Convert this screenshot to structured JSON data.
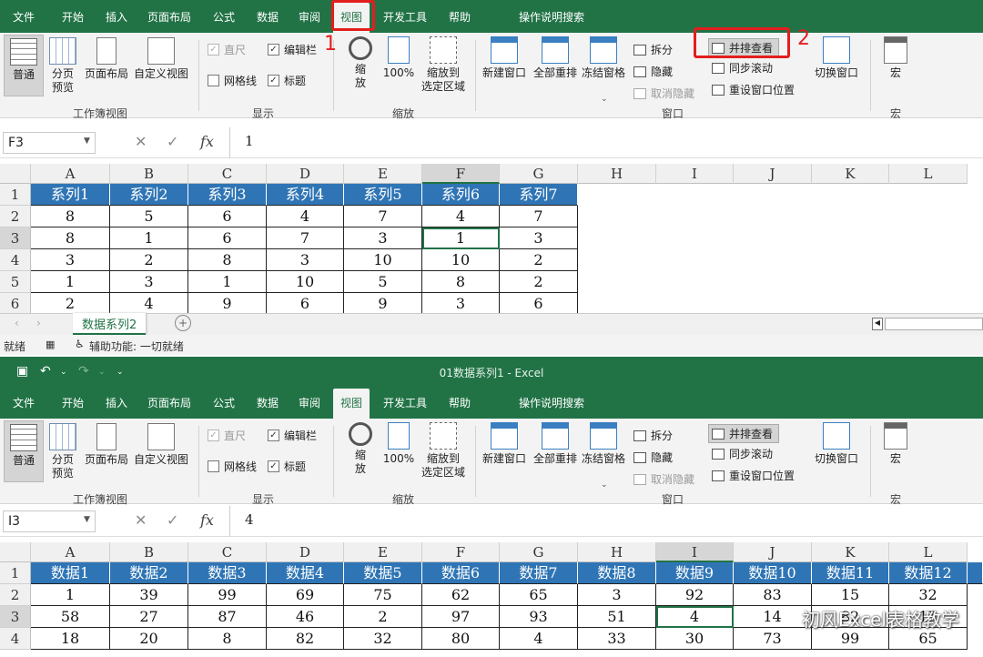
{
  "tabs": [
    "文件",
    "开始",
    "插入",
    "页面布局",
    "公式",
    "数据",
    "审阅",
    "视图",
    "开发工具",
    "帮助",
    "操作说明搜索"
  ],
  "ribbon": {
    "views": {
      "normal": "普通",
      "pagebreak": "分页\n预览",
      "pagelayout": "页面布局",
      "custom": "自定义视图",
      "group": "工作簿视图"
    },
    "show": {
      "ruler": "直尺",
      "formulabar": "编辑栏",
      "gridlines": "网格线",
      "headings": "标题",
      "group": "显示"
    },
    "zoom": {
      "zoom": "缩\n放",
      "z100": "100%",
      "zoomsel": "缩放到\n选定区域",
      "group": "缩放"
    },
    "window": {
      "newwin": "新建窗口",
      "arrange": "全部重排",
      "freeze": "冻结窗格",
      "split": "拆分",
      "hide": "隐藏",
      "unhide": "取消隐藏",
      "sbs": "并排查看",
      "sync": "同步滚动",
      "reset": "重设窗口位置",
      "switch": "切换窗口",
      "group": "窗口"
    },
    "macro": {
      "macro": "宏",
      "group": "宏"
    }
  },
  "annotations": {
    "a1": "1",
    "a2": "2"
  },
  "w1": {
    "namebox": "F3",
    "formula": "1",
    "cols": [
      "A",
      "B",
      "C",
      "D",
      "E",
      "F",
      "G",
      "H",
      "I",
      "J",
      "K",
      "L"
    ],
    "rows": [
      "1",
      "2",
      "3",
      "4",
      "5",
      "6"
    ],
    "header": [
      "系列1",
      "系列2",
      "系列3",
      "系列4",
      "系列5",
      "系列6",
      "系列7"
    ],
    "data": [
      [
        "8",
        "5",
        "6",
        "4",
        "7",
        "4",
        "7"
      ],
      [
        "8",
        "1",
        "6",
        "7",
        "3",
        "1",
        "3"
      ],
      [
        "3",
        "2",
        "8",
        "3",
        "10",
        "10",
        "2"
      ],
      [
        "1",
        "3",
        "1",
        "10",
        "5",
        "8",
        "2"
      ],
      [
        "2",
        "4",
        "9",
        "6",
        "9",
        "3",
        "6"
      ]
    ],
    "sheet": "数据系列2",
    "status": "就绪",
    "access": "辅助功能: 一切就绪"
  },
  "w2": {
    "title": "01数据系列1  -  Excel",
    "namebox": "I3",
    "formula": "4",
    "cols": [
      "A",
      "B",
      "C",
      "D",
      "E",
      "F",
      "G",
      "H",
      "I",
      "J",
      "K",
      "L"
    ],
    "rows": [
      "1",
      "2",
      "3",
      "4"
    ],
    "header": [
      "数据1",
      "数据2",
      "数据3",
      "数据4",
      "数据5",
      "数据6",
      "数据7",
      "数据8",
      "数据9",
      "数据10",
      "数据11",
      "数据12"
    ],
    "data": [
      [
        "1",
        "39",
        "99",
        "69",
        "75",
        "62",
        "65",
        "3",
        "92",
        "83",
        "15",
        "32"
      ],
      [
        "58",
        "27",
        "87",
        "46",
        "2",
        "97",
        "93",
        "51",
        "4",
        "14",
        "82",
        "15"
      ],
      [
        "18",
        "20",
        "8",
        "82",
        "32",
        "80",
        "4",
        "33",
        "30",
        "73",
        "99",
        "65"
      ]
    ]
  },
  "watermark": "初风Excel表格教学"
}
